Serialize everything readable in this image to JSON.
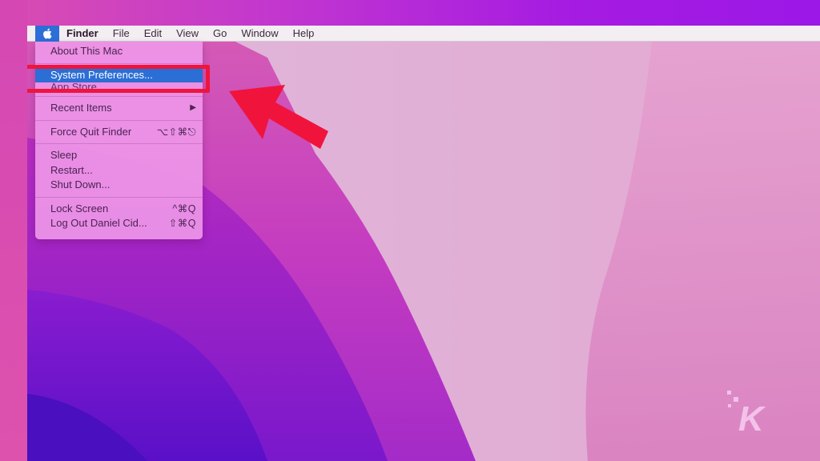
{
  "menubar": {
    "apple_icon": "apple-logo-icon",
    "menus": [
      "Finder",
      "File",
      "Edit",
      "View",
      "Go",
      "Window",
      "Help"
    ],
    "active_app": "Finder"
  },
  "apple_menu": {
    "items": [
      {
        "label": "About This Mac",
        "shortcut": ""
      },
      {
        "label": "System Preferences...",
        "shortcut": "",
        "highlighted": true
      },
      {
        "label": "App Store...",
        "shortcut": ""
      },
      {
        "label": "Recent Items",
        "shortcut": "▶"
      },
      {
        "label": "Force Quit Finder",
        "shortcut": "⌥⇧⌘⎋"
      },
      {
        "label": "Sleep",
        "shortcut": ""
      },
      {
        "label": "Restart...",
        "shortcut": ""
      },
      {
        "label": "Shut Down...",
        "shortcut": ""
      },
      {
        "label": "Lock Screen",
        "shortcut": "^⌘Q"
      },
      {
        "label": "Log Out Daniel Cid...",
        "shortcut": "⇧⌘Q"
      }
    ]
  },
  "annotation": {
    "highlight_color": "#f0143c",
    "arrow_color": "#f0143c",
    "target": "System Preferences..."
  },
  "colors": {
    "menu_highlight": "#2b6ed5",
    "menu_background": "#ee96e8",
    "menubar_background": "#f3eef2"
  },
  "watermark": {
    "letter": "K"
  }
}
